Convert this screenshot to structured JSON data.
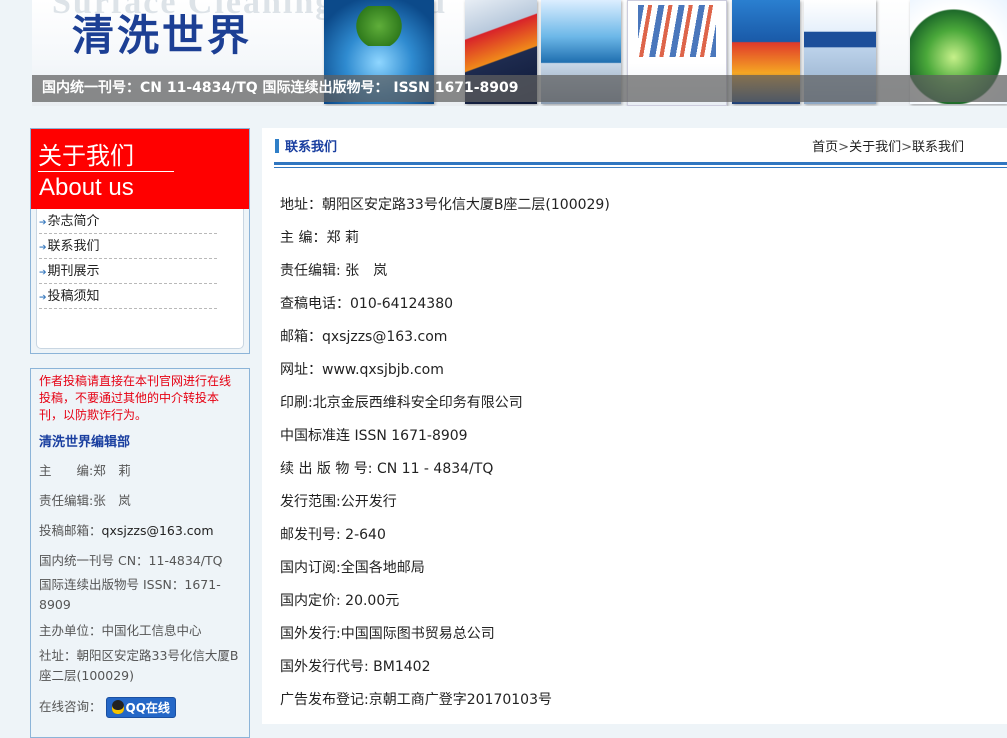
{
  "banner": {
    "ghost_text": "Surface Cleaning World",
    "logo_text": "清洗世界",
    "issn_line": "国内统一刊号：CN 11-4834/TQ 国际连续出版物号： ISSN 1671-8909"
  },
  "about": {
    "title_cn": "关于我们",
    "title_en": "About us",
    "menu": [
      "杂志简介",
      "联系我们",
      "期刊展示",
      "投稿须知"
    ]
  },
  "sidebar_info": {
    "notice": "作者投稿请直接在本刊官网进行在线投稿，不要通过其他的中介转投本刊，以防欺诈行为。",
    "editorial": "清洗世界编辑部",
    "editor": "主　　编:郑　莉",
    "responsible_editor": "责任编辑:张　岚",
    "email_label": "投稿邮箱：",
    "email_value": "qxsjzzs@163.com",
    "cn": "国内统一刊号 CN：11-4834/TQ",
    "issn": "国际连续出版物号 ISSN：1671-8909",
    "host": "主办单位：中国化工信息中心",
    "address": "社址：朝阳区安定路33号化信大厦B座二层(100029)",
    "consult_label": "在线咨询：",
    "qq_button": "QQ在线"
  },
  "main": {
    "title": "联系我们",
    "breadcrumb": [
      "首页",
      "关于我们",
      "联系我们"
    ],
    "breadcrumb_sep": ">",
    "contact_lines": [
      "地址：朝阳区安定路33号化信大厦B座二层(100029)",
      "主 编：郑 莉",
      "责任编辑: 张　岚",
      "查稿电话：010-64124380",
      "邮箱：qxsjzzs@163.com",
      "网址：www.qxsjbjb.com",
      "印刷:北京金辰西维科安全印务有限公司",
      "中国标准连 ISSN 1671-8909",
      "续 出 版 物 号: CN 11 - 4834/TQ",
      "发行范围:公开发行",
      "邮发刊号: 2-640",
      "国内订阅:全国各地邮局",
      "国内定价: 20.00元",
      "国外发行:中国国际图书贸易总公司",
      "国外发行代号: BM1402",
      "广告发布登记:京朝工商广登字20170103号"
    ]
  }
}
